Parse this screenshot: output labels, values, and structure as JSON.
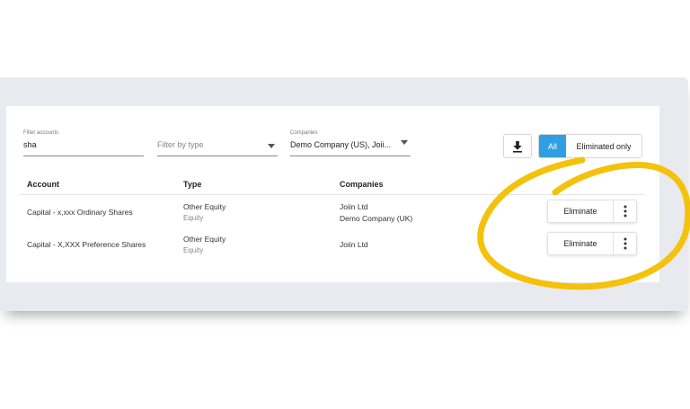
{
  "filters": {
    "account": {
      "label": "Filter accounts",
      "value": "sha"
    },
    "type": {
      "placeholder": "Filter by type"
    },
    "companies": {
      "label": "Companies",
      "value": "Demo Company (US), Joii..."
    }
  },
  "toolbar": {
    "download_icon": "download-icon",
    "toggle_all": "All",
    "toggle_eliminated": "Eliminated only",
    "active_toggle": "All",
    "accent_color": "#2f9fe3"
  },
  "table": {
    "headers": {
      "account": "Account",
      "type": "Type",
      "companies": "Companies"
    },
    "rows": [
      {
        "account": "Capital - x,xxx Ordinary Shares",
        "type": "Other Equity",
        "type_sub": "Equity",
        "companies": [
          "Joiin Ltd",
          "Demo Company (UK)"
        ],
        "action": "Eliminate"
      },
      {
        "account": "Capital - X,XXX Preference Shares",
        "type": "Other Equity",
        "type_sub": "Equity",
        "companies": [
          "Joiin Ltd"
        ],
        "action": "Eliminate"
      }
    ]
  },
  "annotation": {
    "color": "#f4c20d"
  }
}
